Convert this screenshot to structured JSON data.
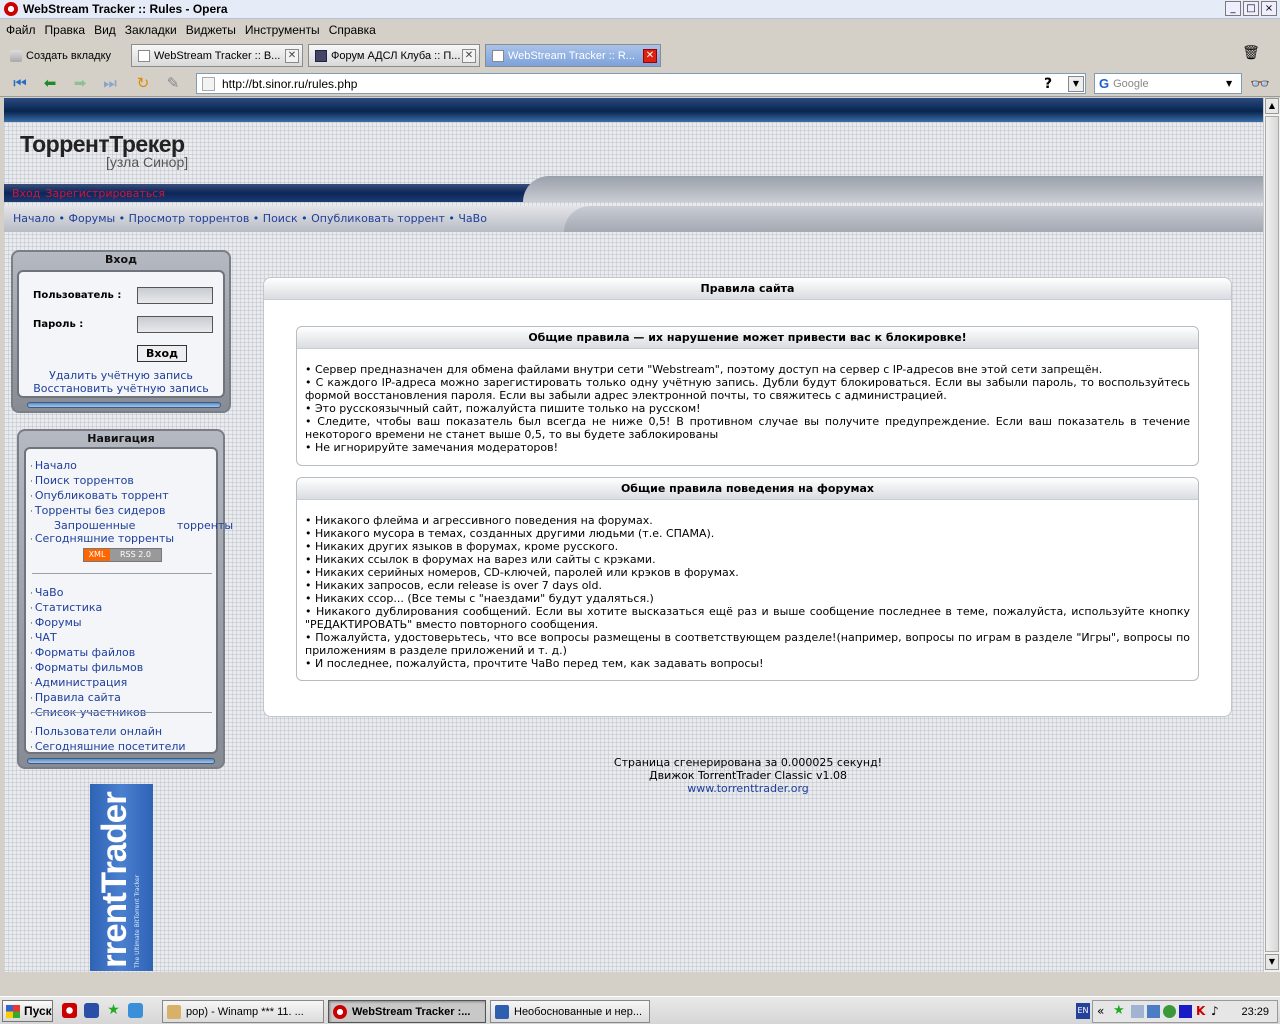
{
  "window": {
    "title": "WebStream Tracker :: Rules - Opera"
  },
  "menu": [
    "Файл",
    "Правка",
    "Вид",
    "Закладки",
    "Виджеты",
    "Инструменты",
    "Справка"
  ],
  "tabs": {
    "new_tab": "Создать вкладку",
    "items": [
      {
        "label": "WebStream Tracker :: В..."
      },
      {
        "label": "Форум АДСЛ Клуба :: П..."
      },
      {
        "label": "WebStream Tracker :: R..."
      }
    ]
  },
  "address": {
    "url": "http://bt.sinor.ru/rules.php",
    "search_placeholder": "Google"
  },
  "site": {
    "logo_main": "ТоррентТрекер",
    "logo_sub": "[узла Синор]",
    "userbar": {
      "login": "Вход",
      "register": "Зарегистрироваться"
    },
    "navlinks": [
      "Начало",
      "Форумы",
      "Просмотр торрентов",
      "Поиск",
      "Опубликовать торрент",
      "ЧаВо"
    ]
  },
  "login_box": {
    "title": "Вход",
    "user_label": "Пользователь :",
    "pass_label": "Пароль :",
    "submit": "Вход",
    "delete": "Удалить учётную запись",
    "restore": "Восстановить учётную запись"
  },
  "nav_box": {
    "title": "Навигация",
    "group1": [
      "Начало",
      "Поиск торрентов",
      "Опубликовать торрент",
      "Торренты без сидеров",
      "Запрошенные торренты",
      "Сегодняшние торренты"
    ],
    "rss": {
      "left": "XML",
      "right": "RSS 2.0"
    },
    "group2": [
      "ЧаВо",
      "Статистика",
      "Форумы",
      "ЧАТ",
      "Форматы файлов",
      "Форматы фильмов",
      "Администрация",
      "Правила сайта",
      "Список участников"
    ],
    "group3": [
      "Пользователи онлайн",
      "Сегодняшние посетители"
    ]
  },
  "banner": {
    "big": "rrentTrader",
    "small": "The Ultimate BitTorrent Tracker"
  },
  "main": {
    "title": "Правила сайта",
    "section1": {
      "title": "Общие правила — их нарушение может привести вас к блокировке!",
      "items": [
        "• Сервер предназначен для обмена файлами внутри сети \"Webstream\", поэтому доступ на сервер с IP-адресов вне этой сети запрещён.",
        "• С каждого IP-адреса можно зарегистировать только одну учётную запись. Дубли будут блокироваться. Если вы забыли пароль, то воспользуйтесь формой восстановления пароля. Если вы забыли адрес электронной почты, то свяжитесь с администрацией.",
        "• Это русскоязычный сайт, пожалуйста пишите только на русском!",
        "• Следите, чтобы ваш показатель был всегда не ниже 0,5! В противном случае вы получите предупреждение. Если ваш показатель в течение некоторого времени не станет выше 0,5, то вы будете заблокированы",
        "• Не игнорируйте замечания модераторов!"
      ]
    },
    "section2": {
      "title": "Общие правила поведения на форумах",
      "items": [
        "• Никакого флейма и агрессивного поведения на форумах.",
        "• Никакого мусора в темах, созданных другими людьми (т.е. СПАМА).",
        "• Никаких других языков в форумах, кроме русского.",
        "• Никаких ссылок в форумах на варез или сайты с крэками.",
        "• Никаких серийных номеров, CD-ключей, паролей или крэков в форумах.",
        "• Никаких запросов, если release is over 7 days old.",
        "• Никаких ссор... (Все темы с \"наездами\" будут удаляться.)",
        "• Никакого дублирования сообщений. Если вы хотите высказаться ещё раз и выше сообщение последнее в теме, пожалуйста, используйте кнопку \"РЕДАКТИРОВАТЬ\" вместо повторного сообщения.",
        "• Пожалуйста, удостоверьтесь, что все вопросы размещены в соответствующем разделе!(например, вопросы по играм в разделе \"Игры\", вопросы по приложениям в разделе приложений и т. д.)",
        "• И последнее, пожалуйста, прочтите ЧаВо перед тем, как задавать вопросы!"
      ]
    }
  },
  "footer": {
    "line1": "Страница сгенерирована за 0.000025 секунд!",
    "line2": "Движок TorrentTrader Classic v1.08",
    "link": "www.torrenttrader.org"
  },
  "taskbar": {
    "start": "Пуск",
    "tasks": [
      "pop) - Winamp *** 11. ...",
      "WebStream Tracker :...",
      "Необоснованные и нер..."
    ],
    "lang": "EN",
    "clock": "23:29"
  }
}
